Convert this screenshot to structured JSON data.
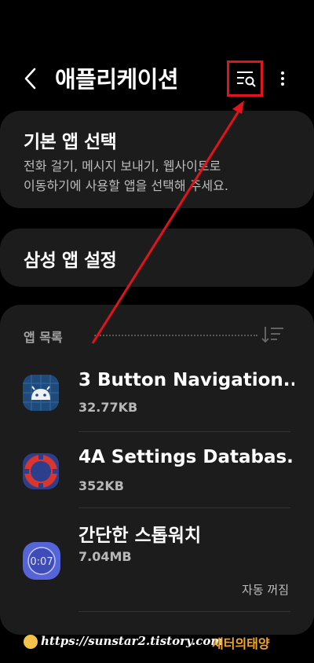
{
  "header": {
    "title": "애플리케이션"
  },
  "default_apps": {
    "title": "기본 앱 선택",
    "description_line1": "전화 걸기, 메시지 보내기, 웹사이트로",
    "description_line2": "이동하기에 사용할 앱을 선택해 주세요."
  },
  "samsung_apps": {
    "title": "삼성 앱 설정"
  },
  "app_list": {
    "label": "앱 목록",
    "items": [
      {
        "name": "3 Button Navigation..",
        "size": "32.77KB",
        "icon": "android-robot-icon"
      },
      {
        "name": "4A Settings Databas..",
        "size": "352KB",
        "icon": "settings-database-icon"
      },
      {
        "name": "간단한 스톱워치",
        "size": "7.04MB",
        "status": "자동 꺼짐",
        "icon": "stopwatch-icon",
        "icon_text": "0:07"
      }
    ]
  },
  "watermark": {
    "url": "https://sunstar2.tistory.com",
    "brand": "새터의태양"
  },
  "colors": {
    "background": "#000000",
    "card": "#1c1c1c",
    "annotation_red": "#e0141c",
    "brand_orange": "#f5a623"
  }
}
